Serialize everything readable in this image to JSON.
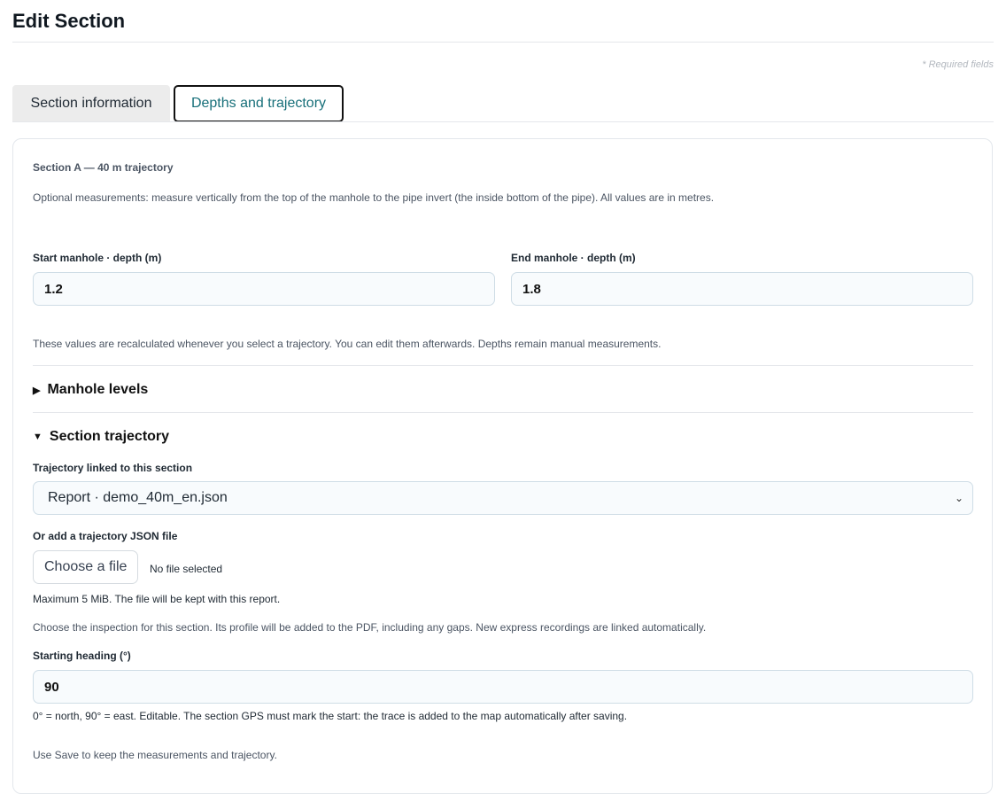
{
  "header": {
    "title": "Edit Section",
    "required_note": "* Required fields"
  },
  "tabs": [
    {
      "label": "Section information",
      "active": false
    },
    {
      "label": "Depths and trajectory",
      "active": true
    }
  ],
  "card": {
    "section_title": "Section A — 40 m trajectory",
    "intro": "Optional measurements: measure vertically from the top of the manhole to the pipe invert (the inside bottom of the pipe). All values are in metres.",
    "start_depth": {
      "label": "Start manhole · depth (m)",
      "value": "1.2"
    },
    "end_depth": {
      "label": "End manhole · depth (m)",
      "value": "1.8"
    },
    "recalc_note": "These values are recalculated whenever you select a trajectory. You can edit them afterwards. Depths remain manual measurements.",
    "manhole_levels": {
      "label": "Manhole levels",
      "expanded": false
    },
    "section_trajectory": {
      "label": "Section trajectory",
      "expanded": true
    },
    "trajectory_select": {
      "label": "Trajectory linked to this section",
      "selected": "Report · demo_40m_en.json"
    },
    "file_upload": {
      "label": "Or add a trajectory JSON file",
      "button": "Choose a file",
      "status": "No file selected",
      "hint": "Maximum 5 MiB. The file will be kept with this report."
    },
    "inspection_note": "Choose the inspection for this section. Its profile will be added to the PDF, including any gaps. New express recordings are linked automatically.",
    "heading": {
      "label": "Starting heading (°)",
      "value": "90",
      "hint": "0° = north, 90° = east. Editable. The section GPS must mark the start: the trace is added to the map automatically after saving."
    },
    "save_note": "Use Save to keep the measurements and trajectory."
  },
  "icons": {
    "collapsed": "triangle-right-icon",
    "expanded": "triangle-down-icon",
    "select_chevron": "chevron-down-icon"
  },
  "colors": {
    "active_tab_text": "#18707a",
    "input_background": "#f8fbfd",
    "input_border": "#cfdde6"
  }
}
